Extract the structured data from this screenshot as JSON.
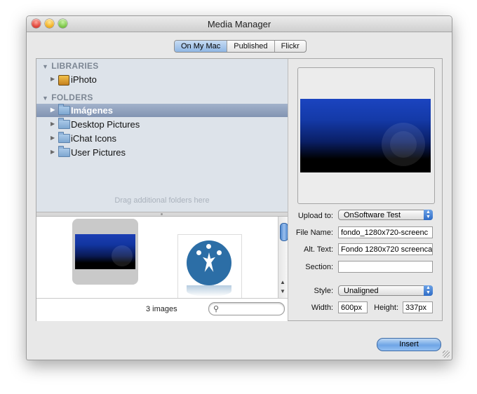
{
  "window": {
    "title": "Media Manager"
  },
  "tabs": [
    {
      "label": "On My Mac",
      "active": true
    },
    {
      "label": "Published",
      "active": false
    },
    {
      "label": "Flickr",
      "active": false
    }
  ],
  "sidebar": {
    "libraries_header": "LIBRARIES",
    "libraries": [
      {
        "label": "iPhoto",
        "icon": "iphoto-icon"
      }
    ],
    "folders_header": "FOLDERS",
    "folders": [
      {
        "label": "Imágenes",
        "selected": true
      },
      {
        "label": "Desktop Pictures",
        "selected": false
      },
      {
        "label": "iChat Icons",
        "selected": false
      },
      {
        "label": "User Pictures",
        "selected": false
      }
    ],
    "drag_hint": "Drag additional folders here"
  },
  "browser": {
    "count": "3 images",
    "search_placeholder": ""
  },
  "form": {
    "upload_to_label": "Upload to:",
    "upload_to_value": "OnSoftware Test",
    "file_name_label": "File Name:",
    "file_name_value": "fondo_1280x720-screenc",
    "alt_text_label": "Alt. Text:",
    "alt_text_value": "Fondo 1280x720 screenca",
    "section_label": "Section:",
    "section_value": "",
    "style_label": "Style:",
    "style_value": "Unaligned",
    "width_label": "Width:",
    "width_value": "600px",
    "height_label": "Height:",
    "height_value": "337px"
  },
  "actions": {
    "insert_label": "Insert"
  },
  "colors": {
    "accent": "#6fa5e6",
    "selection": "#8294b2"
  }
}
